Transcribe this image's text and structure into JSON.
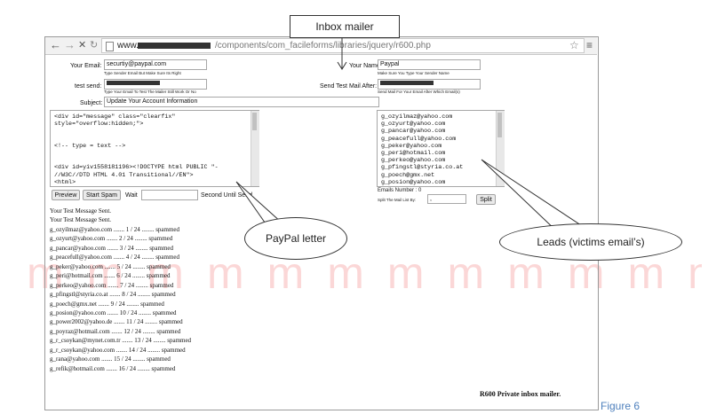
{
  "browser": {
    "url_prefix": "www.",
    "url_path": "/components/com_facileforms/libraries/jquery/r600.php",
    "back_icon": "←",
    "forward_icon": "→",
    "close_icon": "✕",
    "refresh_icon": "↻",
    "star_icon": "☆",
    "menu_icon": "≡"
  },
  "form": {
    "your_email_label": "Your Email:",
    "your_email_value": "securtiy@paypal.com",
    "your_email_hint": "Type Sender Email But Make Sure Its Right",
    "your_name_label": "Your Name:",
    "your_name_value": "Paypal",
    "your_name_hint": "Make Sure You Type Your Sender Name",
    "test_send_label": "test send:",
    "test_send_hint": "Type Your Email To Test The Mailer Still Work Or No",
    "send_after_label": "Send Test Mail After:",
    "send_after_hint": "Send Mail For Your Email After Which Email(s)",
    "subject_label": "Subject:",
    "subject_value": "Update Your Account Information",
    "letter_lines": [
      "<div id=\"message\" class=\"clearfix\"",
      "style=\"overflow:hidden;\">",
      "",
      "",
      "<!-- type = text -->",
      "",
      "",
      "<div id=yiv1558181196><!DOCTYPE html PUBLIC \"-",
      "//W3C//DTD HTML 4.01 Transitional//EN\">",
      "<html>"
    ],
    "emails": [
      "g_ozyilmaz@yahoo.com",
      "g_ozyurt@yahoo.com",
      "g_pancar@yahoo.com",
      "g_peacefull@yahoo.com",
      "g_peker@yahoo.com",
      "g_peri@hotmail.com",
      "g_perkeo@yahoo.com",
      "g_pfingstl@styria.co.at",
      "g_poech@gmx.net",
      "g_posion@yahoo.com"
    ],
    "preview_label": "Preview",
    "start_spam_label": "Start Spam",
    "wait_label": "Wait",
    "second_until_label": "Second Until Send",
    "emails_number_label": "Emails Number : 0",
    "split_label": "Split The Mail List By:",
    "split_value": ",",
    "split_button_label": "Split"
  },
  "log": {
    "sent_lines": [
      "Your Test Message Sent.",
      "Your Test Message Sent."
    ],
    "entries": [
      "g_ozyilmaz@yahoo.com ....... 1 / 24 ........ spammed",
      "g_ozyurt@yahoo.com ....... 2 / 24 ........ spammed",
      "g_pancar@yahoo.com ....... 3 / 24 ........ spammed",
      "g_peacefull@yahoo.com ....... 4 / 24 ........ spammed",
      "g_peker@yahoo.com ....... 5 / 24 ........ spammed",
      "g_peri@hotmail.com ....... 6 / 24 ........ spammed",
      "g_perkeo@yahoo.com ....... 7 / 24 ........ spammed",
      "g_pfingstl@styria.co.at ....... 8 / 24 ........ spammed",
      "g_poech@gmx.net ....... 9 / 24 ........ spammed",
      "g_posion@yahoo.com ....... 10 / 24 ........ spammed",
      "g_power2002@yahoo.de ....... 11 / 24 ........ spammed",
      "g_poyraz@hotmail.com ....... 12 / 24 ........ spammed",
      "g_r_csoykan@mynet.com.tr ....... 13 / 24 ........ spammed",
      "g_r_csoykan@yahoo.com ....... 14 / 24 ........ spammed",
      "g_rana@yahoo.com ....... 15 / 24 ........ spammed",
      "g_refik@hotmail.com ....... 16 / 24 ........ spammed"
    ]
  },
  "footer": {
    "brand": "R600 Private inbox mailer."
  },
  "annotations": {
    "inbox_mailer": "Inbox mailer",
    "paypal_letter": "PayPal letter",
    "leads": "Leads (victims email’s)",
    "figure": "Figure 6"
  },
  "colors": {
    "watermark": "#eb4b4b",
    "figure_caption": "#4f81bd"
  }
}
